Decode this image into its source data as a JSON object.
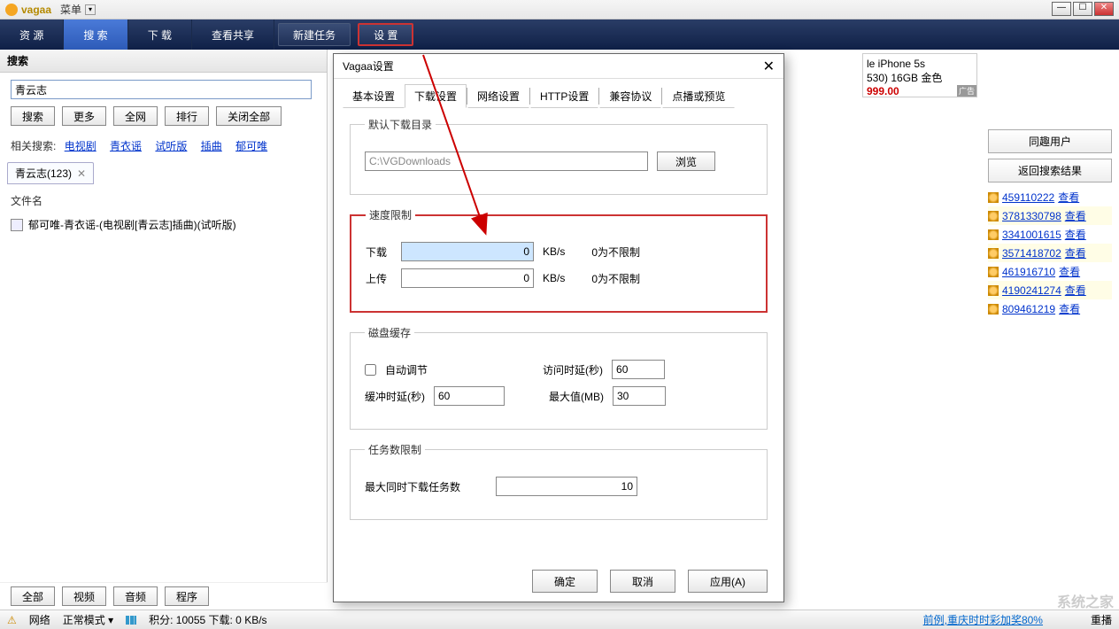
{
  "app": {
    "name": "vagaa",
    "menu": "菜单"
  },
  "main_tabs": {
    "t0": "资  源",
    "t1": "搜  索",
    "t2": "下  载",
    "t3": "查看共享",
    "bt0": "新建任务",
    "bt1": "设  置"
  },
  "search": {
    "header": "搜索",
    "value": "青云志",
    "btn_search": "搜索",
    "btn_more": "更多",
    "btn_all": "全网",
    "btn_rank": "排行",
    "btn_closeall": "关闭全部",
    "related_label": "相关搜索:",
    "related": [
      "电视剧",
      "青衣谣",
      "试听版",
      "插曲",
      "郁可唯"
    ],
    "tab": "青云志(123)",
    "col_filename": "文件名",
    "file0": "郁可唯-青衣谣-(电视剧[青云志]插曲)(试听版)",
    "bottom": [
      "全部",
      "视频",
      "音频",
      "程序"
    ]
  },
  "ad": {
    "line1": "le iPhone 5s",
    "line2": "530) 16GB 金色",
    "price": "999.00",
    "tag": "广告"
  },
  "rside": {
    "btn1": "同趣用户",
    "btn2": "返回搜索结果",
    "view": "查看",
    "users": [
      "459110222",
      "3781330798",
      "3341001615",
      "3571418702",
      "461916710",
      "4190241274",
      "809461219"
    ]
  },
  "dialog": {
    "title": "Vagaa设置",
    "tabs": [
      "基本设置",
      "下载设置",
      "网络设置",
      "HTTP设置",
      "兼容协议",
      "点播或预览"
    ],
    "grp_dir": "默认下载目录",
    "dir_value": "C:\\VGDownloads",
    "browse": "浏览",
    "grp_speed": "速度限制",
    "dl_label": "下载",
    "ul_label": "上传",
    "dl_val": "0",
    "ul_val": "0",
    "unit": "KB/s",
    "note": "0为不限制",
    "grp_cache": "磁盘缓存",
    "auto": "自动调节",
    "buf_label": "缓冲时延(秒)",
    "buf_val": "60",
    "acc_label": "访问时延(秒)",
    "acc_val": "60",
    "max_label": "最大值(MB)",
    "max_val": "30",
    "grp_task": "任务数限制",
    "task_label": "最大同时下载任务数",
    "task_val": "10",
    "ok": "确定",
    "cancel": "取消",
    "apply": "应用(A)"
  },
  "status": {
    "net": "网络",
    "mode": "正常模式 ▾",
    "score": "积分:  10055  下载: 0 KB/s",
    "news": "前例,重庆时时彩加奖80%",
    "reset": "重播"
  },
  "watermark": "系统之家"
}
